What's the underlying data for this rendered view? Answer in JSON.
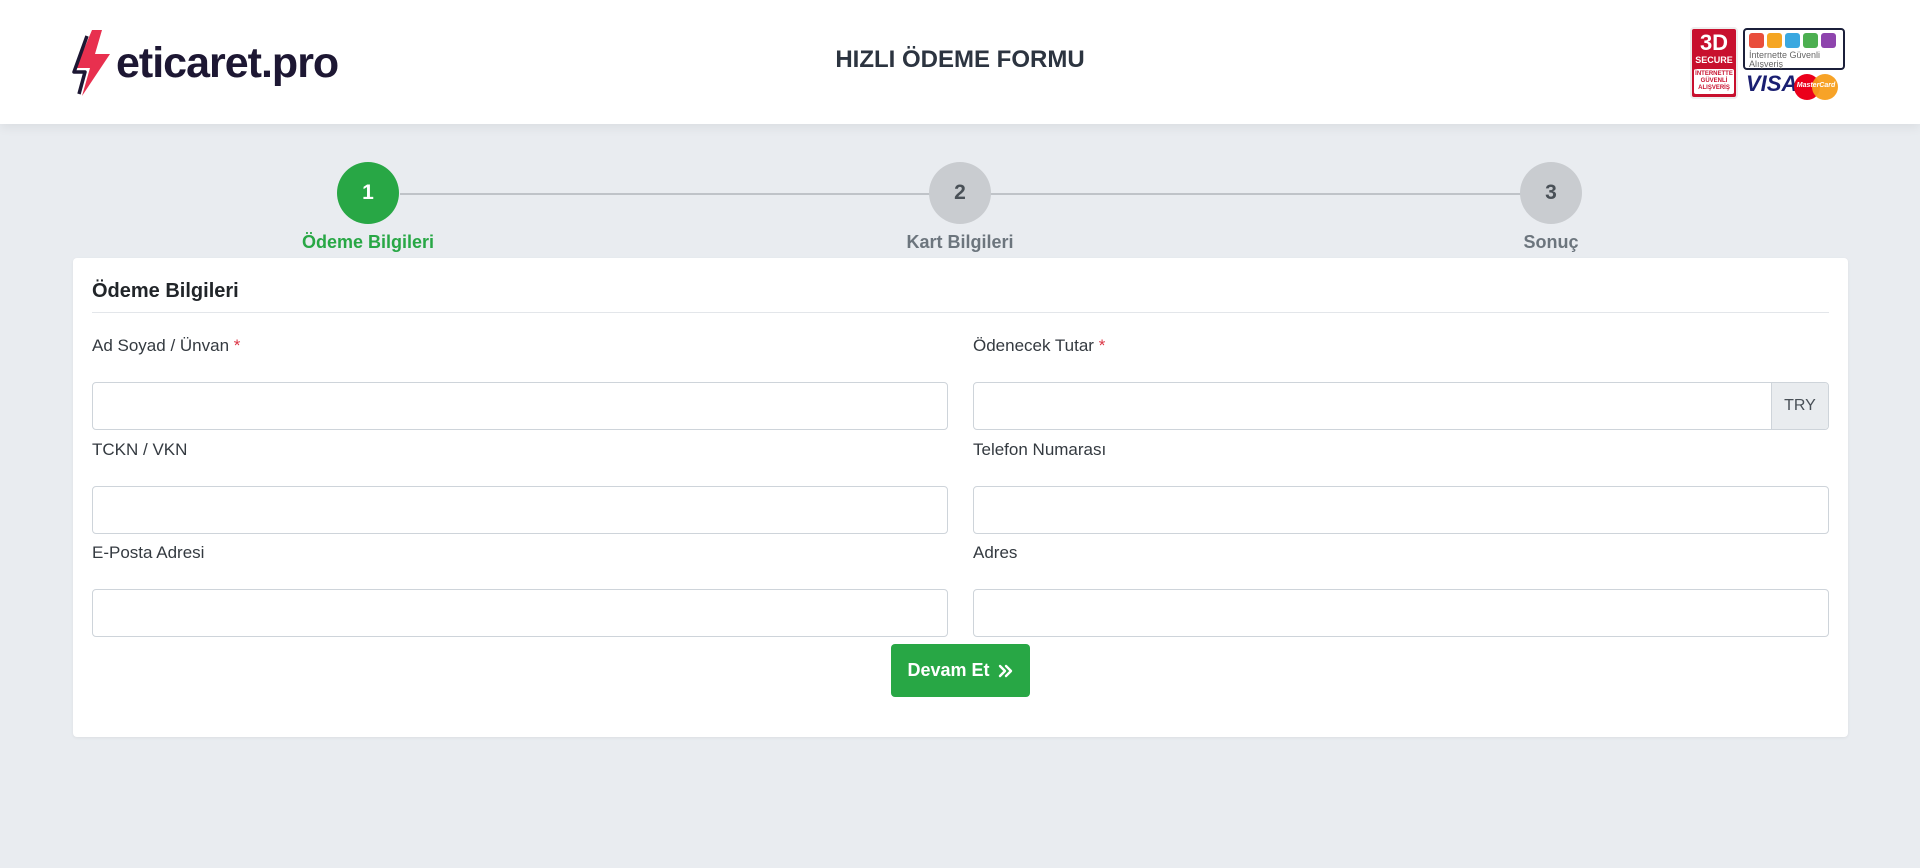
{
  "header": {
    "logo_text": "eticaret.pro",
    "title": "HIZLI ÖDEME FORMU",
    "badge_3d": {
      "big": "3D",
      "mid": "SECURE",
      "small": "İNTERNETTE GÜVENLİ ALIŞVERİŞ"
    },
    "badge_stars_text": "İnternette Güvenli Alışveriş",
    "visa": "VISA",
    "mastercard": "MasterCard"
  },
  "stepper": {
    "steps": [
      {
        "number": "1",
        "label": "Ödeme Bilgileri",
        "state": "active"
      },
      {
        "number": "2",
        "label": "Kart Bilgileri",
        "state": "todo"
      },
      {
        "number": "3",
        "label": "Sonuç",
        "state": "todo"
      }
    ]
  },
  "form": {
    "title": "Ödeme Bilgileri",
    "required_mark": "*",
    "fields": {
      "name": {
        "label": "Ad Soyad / Ünvan",
        "value": "",
        "placeholder": ""
      },
      "amount": {
        "label": "Ödenecek Tutar",
        "value": "",
        "placeholder": "",
        "currency": "TRY"
      },
      "tckn": {
        "label": "TCKN / VKN",
        "value": "",
        "placeholder": ""
      },
      "phone": {
        "label": "Telefon Numarası",
        "value": "",
        "placeholder": ""
      },
      "email": {
        "label": "E-Posta Adresi",
        "value": "",
        "placeholder": ""
      },
      "address": {
        "label": "Adres",
        "value": "",
        "placeholder": ""
      }
    },
    "continue_label": "Devam Et"
  },
  "colors": {
    "accent": "#28a745",
    "background": "#e9ecf0",
    "required": "#dc3545",
    "logo_bolt": "#e8304f"
  }
}
